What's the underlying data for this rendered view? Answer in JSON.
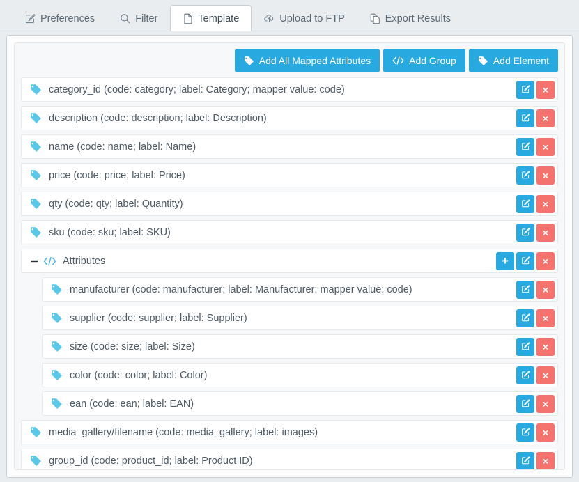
{
  "tabs": [
    {
      "label": "Preferences",
      "icon": "edit-square-icon",
      "active": false
    },
    {
      "label": "Filter",
      "icon": "search-icon",
      "active": false
    },
    {
      "label": "Template",
      "icon": "file-icon",
      "active": true
    },
    {
      "label": "Upload to FTP",
      "icon": "cloud-upload-icon",
      "active": false
    },
    {
      "label": "Export Results",
      "icon": "copy-files-icon",
      "active": false
    }
  ],
  "toolbar": {
    "add_all_mapped_attributes": "Add All Mapped Attributes",
    "add_group": "Add Group",
    "add_element": "Add Element"
  },
  "colors": {
    "accent_blue": "#28a9e0",
    "danger_red": "#f4736f",
    "tag_icon_blue": "#5bc8e8",
    "text": "#4e5b67",
    "page_bg": "#e9edef"
  },
  "actions": {
    "add_label": "+",
    "edit_label": "edit-icon",
    "delete_label": "×"
  },
  "rows": [
    {
      "type": "element",
      "icon": "tag-icon",
      "label": "category_id (code: category; label: Category; mapper value: code)",
      "nested": false,
      "actions": [
        "edit",
        "delete"
      ]
    },
    {
      "type": "element",
      "icon": "tag-icon",
      "label": "description (code: description; label: Description)",
      "nested": false,
      "actions": [
        "edit",
        "delete"
      ]
    },
    {
      "type": "element",
      "icon": "tag-icon",
      "label": "name (code: name; label: Name)",
      "nested": false,
      "actions": [
        "edit",
        "delete"
      ]
    },
    {
      "type": "element",
      "icon": "tag-icon",
      "label": "price (code: price; label: Price)",
      "nested": false,
      "actions": [
        "edit",
        "delete"
      ]
    },
    {
      "type": "element",
      "icon": "tag-icon",
      "label": "qty (code: qty; label: Quantity)",
      "nested": false,
      "actions": [
        "edit",
        "delete"
      ]
    },
    {
      "type": "element",
      "icon": "tag-icon",
      "label": "sku (code: sku; label: SKU)",
      "nested": false,
      "actions": [
        "edit",
        "delete"
      ]
    },
    {
      "type": "group",
      "icon": "code-icon",
      "label": "Attributes",
      "collapse_icon": "minus-icon",
      "nested": false,
      "actions": [
        "add",
        "edit",
        "delete"
      ]
    },
    {
      "type": "element",
      "icon": "tag-icon",
      "label": "manufacturer (code: manufacturer; label: Manufacturer; mapper value: code)",
      "nested": true,
      "actions": [
        "edit",
        "delete"
      ]
    },
    {
      "type": "element",
      "icon": "tag-icon",
      "label": "supplier (code: supplier; label: Supplier)",
      "nested": true,
      "actions": [
        "edit",
        "delete"
      ]
    },
    {
      "type": "element",
      "icon": "tag-icon",
      "label": "size (code: size; label: Size)",
      "nested": true,
      "actions": [
        "edit",
        "delete"
      ]
    },
    {
      "type": "element",
      "icon": "tag-icon",
      "label": "color (code: color; label: Color)",
      "nested": true,
      "actions": [
        "edit",
        "delete"
      ]
    },
    {
      "type": "element",
      "icon": "tag-icon",
      "label": "ean (code: ean; label: EAN)",
      "nested": true,
      "actions": [
        "edit",
        "delete"
      ]
    },
    {
      "type": "element",
      "icon": "tag-icon",
      "label": "media_gallery/filename (code: media_gallery; label: images)",
      "nested": false,
      "actions": [
        "edit",
        "delete"
      ]
    },
    {
      "type": "element",
      "icon": "tag-icon",
      "label": "group_id (code: product_id; label: Product ID)",
      "nested": false,
      "actions": [
        "edit",
        "delete"
      ]
    }
  ]
}
